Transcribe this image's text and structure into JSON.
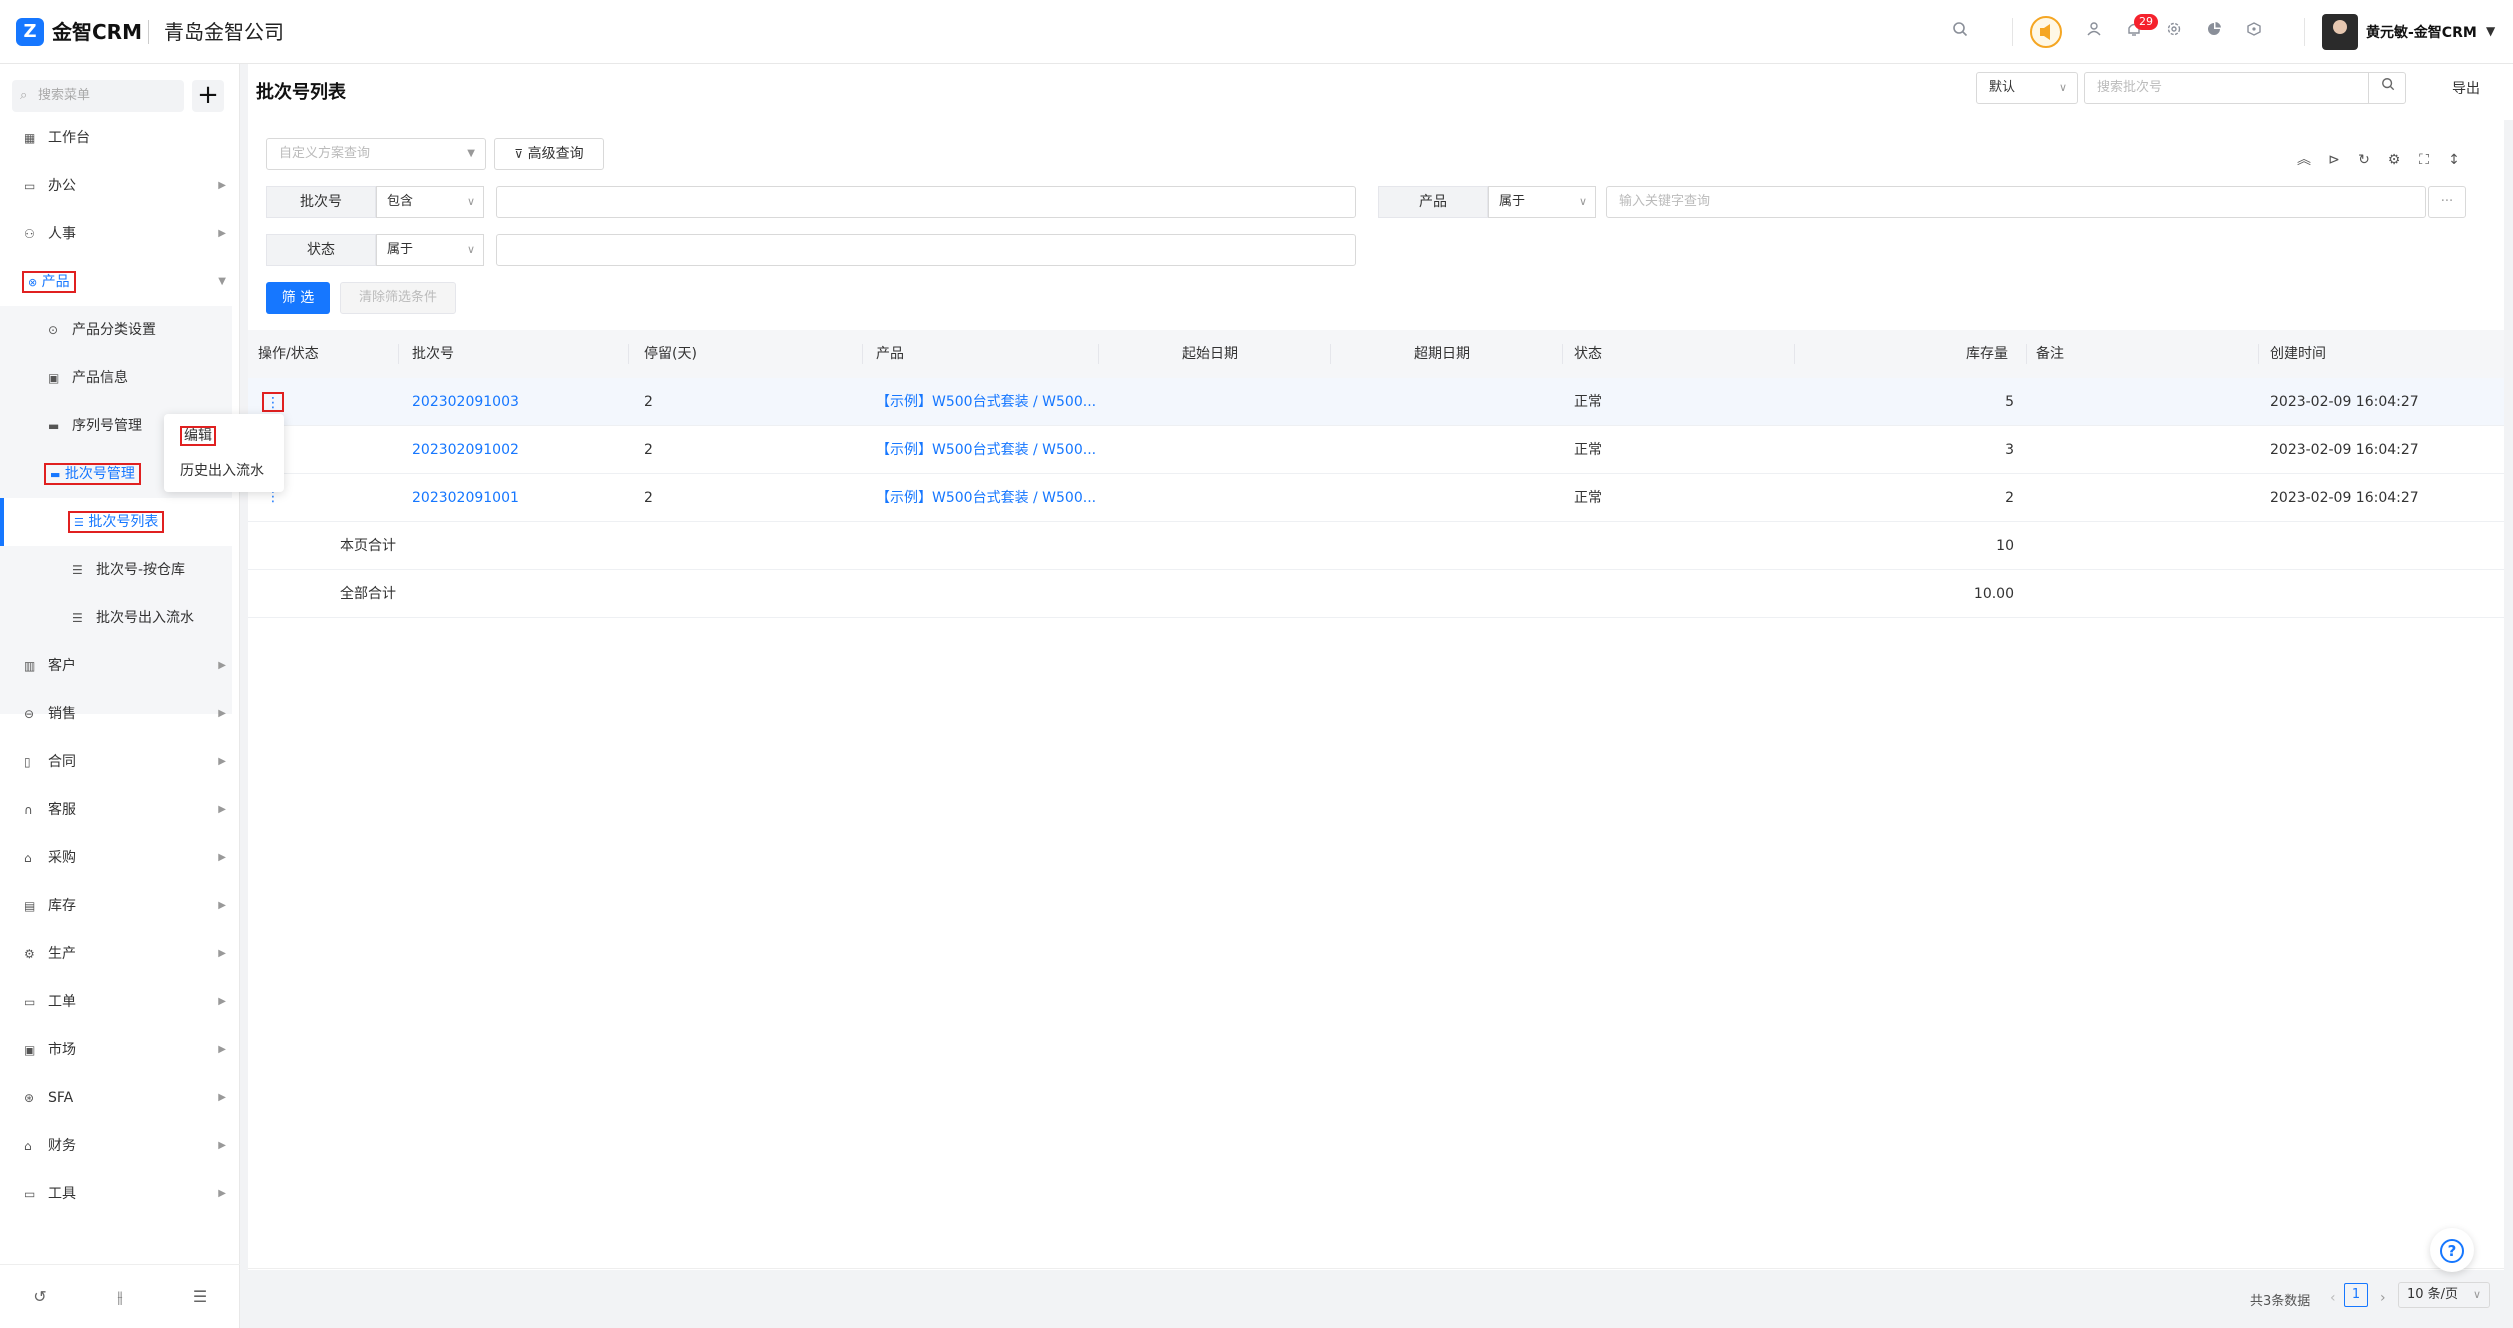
{
  "app": {
    "logo_glyph": "Z",
    "name": "金智CRM",
    "company": "青岛金智公司"
  },
  "topbar": {
    "icons": [
      "search-icon",
      "voice-icon",
      "contacts-icon",
      "bell-icon",
      "gear-icon",
      "chart-icon",
      "box-icon"
    ],
    "notification_count": "29",
    "user_name": "黄元敏-金智CRM",
    "accent_color": "#1677ff",
    "voice_color": "#f5a623"
  },
  "sidebar": {
    "search_placeholder": "搜索菜单",
    "add_label": "+",
    "items": [
      {
        "label": "工作台"
      },
      {
        "label": "办公"
      },
      {
        "label": "人事"
      },
      {
        "label": "产品"
      },
      {
        "label": "客户"
      },
      {
        "label": "销售"
      },
      {
        "label": "合同"
      },
      {
        "label": "客服"
      },
      {
        "label": "采购"
      },
      {
        "label": "库存"
      },
      {
        "label": "生产"
      },
      {
        "label": "工单"
      },
      {
        "label": "市场"
      },
      {
        "label": "SFA"
      },
      {
        "label": "财务"
      },
      {
        "label": "工具"
      }
    ],
    "product_sub": [
      {
        "label": "产品分类设置"
      },
      {
        "label": "产品信息"
      },
      {
        "label": "序列号管理"
      },
      {
        "label": "批次号管理"
      }
    ],
    "batch_sub": [
      {
        "label": "批次号列表"
      },
      {
        "label": "批次号-按仓库"
      },
      {
        "label": "批次号出入流水"
      }
    ]
  },
  "popup": {
    "edit": "编辑",
    "history": "历史出入流水"
  },
  "header": {
    "title": "批次号列表",
    "view_select": "默认",
    "search_placeholder": "搜索批次号",
    "export_label": "导出"
  },
  "filters": {
    "scheme_placeholder": "自定义方案查询",
    "advanced_label": "高级查询",
    "batch_label": "批次号",
    "batch_op": "包含",
    "product_label": "产品",
    "product_op": "属于",
    "product_placeholder": "输入关键字查询",
    "product_more": "···",
    "status_label": "状态",
    "status_op": "属于",
    "filter_btn": "筛 选",
    "clear_btn": "清除筛选条件"
  },
  "table": {
    "columns": [
      "操作/状态",
      "批次号",
      "停留(天)",
      "产品",
      "起始日期",
      "超期日期",
      "状态",
      "库存量",
      "备注",
      "创建时间"
    ],
    "rows": [
      {
        "batch": "202302091003",
        "stay": "2",
        "product": "【示例】W500台式套装 / W500...",
        "start": "",
        "expire": "",
        "status": "正常",
        "stock": "5",
        "note": "",
        "created": "2023-02-09 16:04:27"
      },
      {
        "batch": "202302091002",
        "stay": "2",
        "product": "【示例】W500台式套装 / W500...",
        "start": "",
        "expire": "",
        "status": "正常",
        "stock": "3",
        "note": "",
        "created": "2023-02-09 16:04:27"
      },
      {
        "batch": "202302091001",
        "stay": "2",
        "product": "【示例】W500台式套装 / W500...",
        "start": "",
        "expire": "",
        "status": "正常",
        "stock": "2",
        "note": "",
        "created": "2023-02-09 16:04:27"
      }
    ],
    "page_total_label": "本页合计",
    "page_total": "10",
    "all_total_label": "全部合计",
    "all_total": "10.00"
  },
  "footer": {
    "total_text": "共3条数据",
    "current_page": "1",
    "page_size": "10 条/页"
  },
  "help": {
    "label": "?"
  }
}
